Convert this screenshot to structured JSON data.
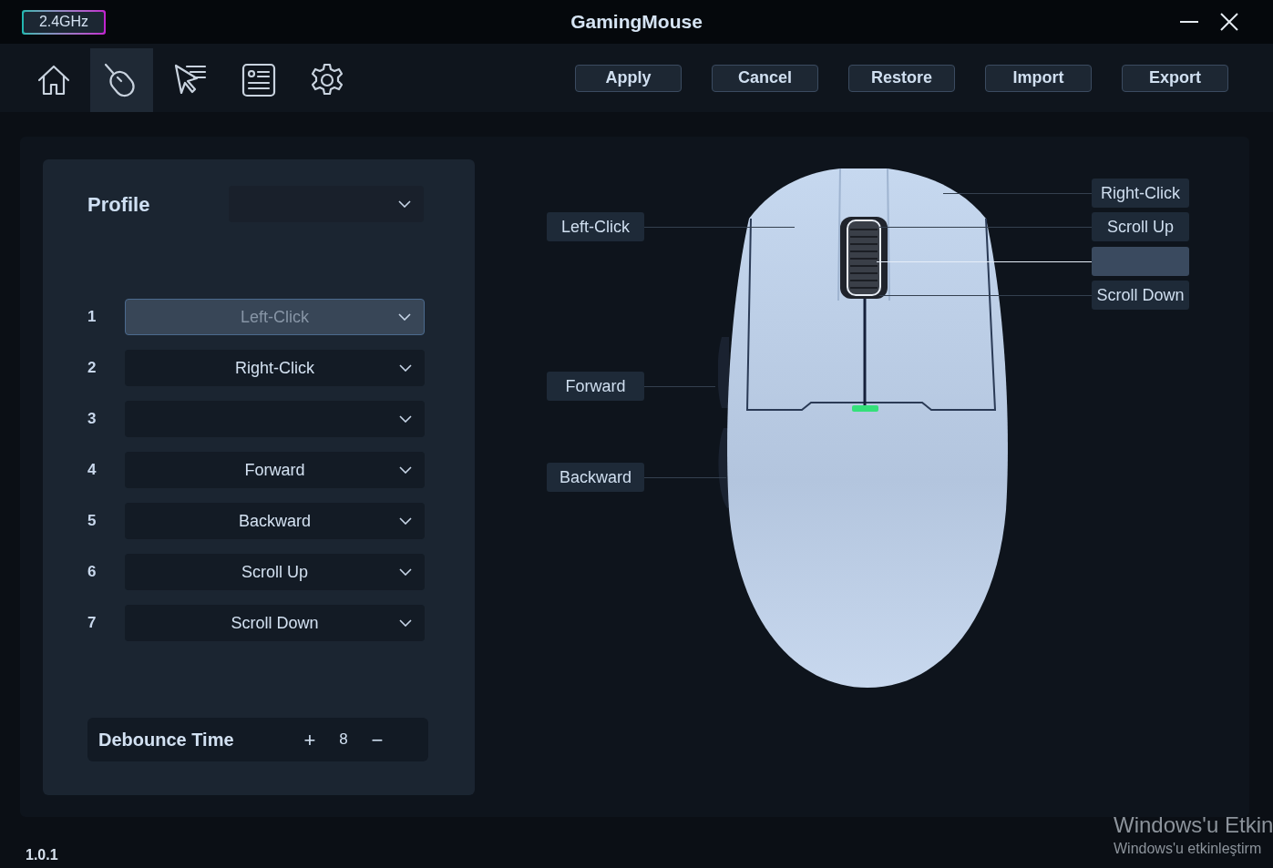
{
  "title_bar": {
    "connection_badge": "2.4GHz",
    "title": "GamingMouse"
  },
  "nav_tabs": [
    {
      "kind": "home",
      "selected": false
    },
    {
      "kind": "mouse",
      "selected": true
    },
    {
      "kind": "pointer",
      "selected": false
    },
    {
      "kind": "document",
      "selected": false
    },
    {
      "kind": "settings",
      "selected": false
    }
  ],
  "actions": [
    "Apply",
    "Cancel",
    "Restore",
    "Import",
    "Export"
  ],
  "profile": {
    "label": "Profile"
  },
  "button_mappings": [
    {
      "number": "1",
      "value": "Left-Click",
      "selected": true
    },
    {
      "number": "2",
      "value": "Right-Click",
      "selected": false
    },
    {
      "number": "3",
      "selected": false
    },
    {
      "number": "4",
      "value": "Forward",
      "selected": false
    },
    {
      "number": "5",
      "value": "Backward",
      "selected": false
    },
    {
      "number": "6",
      "value": "Scroll Up",
      "selected": false
    },
    {
      "number": "7",
      "value": "Scroll Down",
      "selected": false
    }
  ],
  "debounce": {
    "label": "Debounce Time",
    "increase": "+",
    "value": "8",
    "decrease": "−"
  },
  "callouts": [
    {
      "label": "Right-Click",
      "selected": false
    },
    {
      "label": "Left-Click",
      "selected": false
    },
    {
      "label": "Scroll Up",
      "selected": false
    },
    {
      "selected": true
    },
    {
      "label": "Scroll Down",
      "selected": false
    },
    {
      "label": "Forward",
      "selected": false
    },
    {
      "label": "Backward",
      "selected": false
    }
  ],
  "version": "1.0.1",
  "os_overlay": {
    "title": "Windows'u Etkin",
    "subtitle": "Windows'u etkinleştirm"
  }
}
